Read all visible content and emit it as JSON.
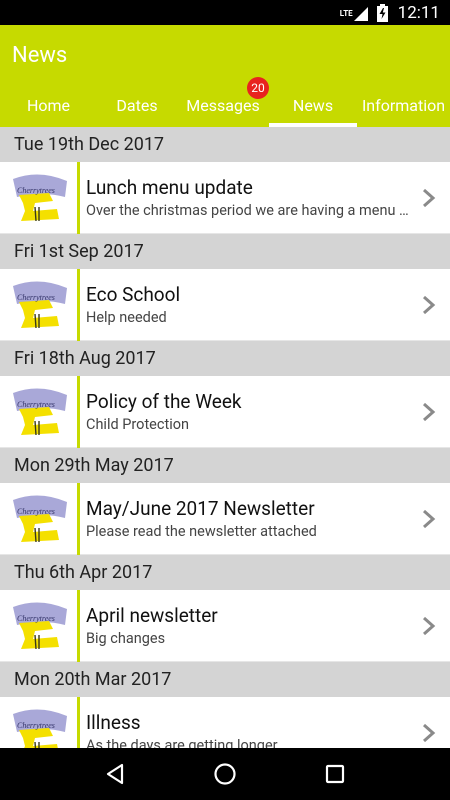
{
  "status_bar": {
    "network_label": "LTE",
    "time": "12:11"
  },
  "app_bar": {
    "title": "News",
    "accent": "#c6da00"
  },
  "tabs": [
    {
      "label": "Home",
      "active": false
    },
    {
      "label": "Dates",
      "active": false
    },
    {
      "label": "Messages",
      "active": false,
      "badge": "20"
    },
    {
      "label": "News",
      "active": true
    },
    {
      "label": "Information",
      "active": false
    }
  ],
  "news": [
    {
      "date": "Tue 19th Dec 2017",
      "title": "Lunch menu update",
      "subtitle": "Over the christmas period we are having a menu change"
    },
    {
      "date": "Fri 1st Sep 2017",
      "title": "Eco School",
      "subtitle": "Help needed"
    },
    {
      "date": "Fri 18th Aug 2017",
      "title": "Policy of the Week",
      "subtitle": "Child Protection"
    },
    {
      "date": "Mon 29th May 2017",
      "title": "May/June 2017 Newsletter",
      "subtitle": "Please read the newsletter attached"
    },
    {
      "date": "Thu 6th Apr 2017",
      "title": "April newsletter",
      "subtitle": "Big changes"
    },
    {
      "date": "Mon 20th Mar 2017",
      "title": "Illness",
      "subtitle": "As the days are getting longer"
    }
  ],
  "logo_text": "Cherrytrees",
  "nav": {
    "back_icon": "back-triangle-icon",
    "home_icon": "home-circle-icon",
    "recents_icon": "recents-square-icon"
  }
}
